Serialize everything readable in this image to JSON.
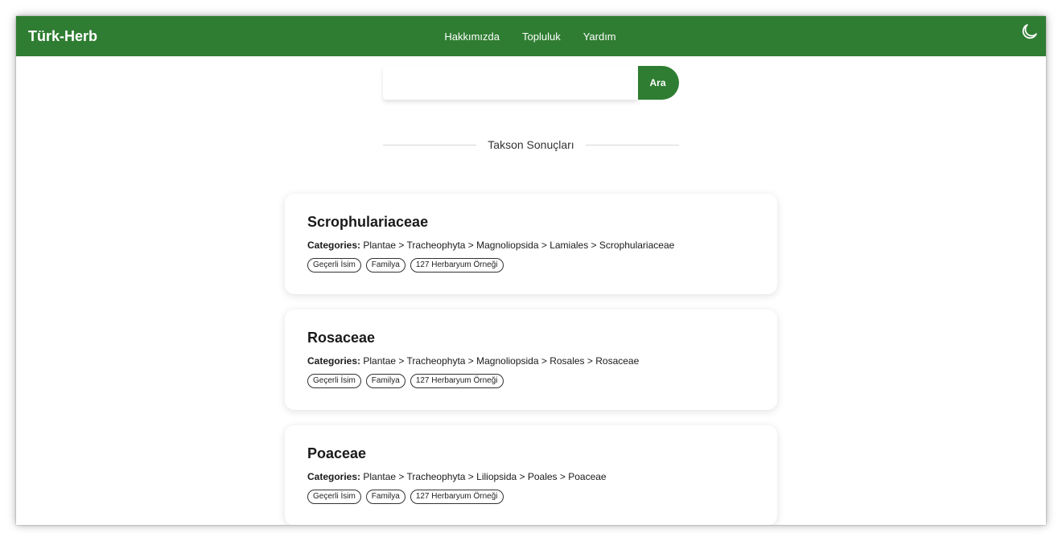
{
  "navbar": {
    "brand": "Türk-Herb",
    "links": [
      "Hakkımızda",
      "Topluluk",
      "Yardım"
    ],
    "theme_icon": "moon-icon"
  },
  "search": {
    "value": "",
    "placeholder": "",
    "button_label": "Ara"
  },
  "results": {
    "heading": "Takson Sonuçları",
    "categories_label": "Categories:",
    "items": [
      {
        "title": "Scrophulariaceae",
        "categories": "Plantae > Tracheophyta > Magnoliopsida > Lamiales > Scrophulariaceae",
        "tags": [
          "Geçerli İsim",
          "Familya",
          "127 Herbaryum Örneği"
        ]
      },
      {
        "title": "Rosaceae",
        "categories": "Plantae > Tracheophyta > Magnoliopsida > Rosales > Rosaceae",
        "tags": [
          "Geçerli İsim",
          "Familya",
          "127 Herbaryum Örneği"
        ]
      },
      {
        "title": "Poaceae",
        "categories": "Plantae > Tracheophyta > Liliopsida > Poales > Poaceae",
        "tags": [
          "Geçerli İsim",
          "Familya",
          "127 Herbaryum Örneği"
        ]
      }
    ]
  },
  "colors": {
    "brand_green": "#2f7d32",
    "background": "#ffffff",
    "text": "#1a1a1a"
  }
}
